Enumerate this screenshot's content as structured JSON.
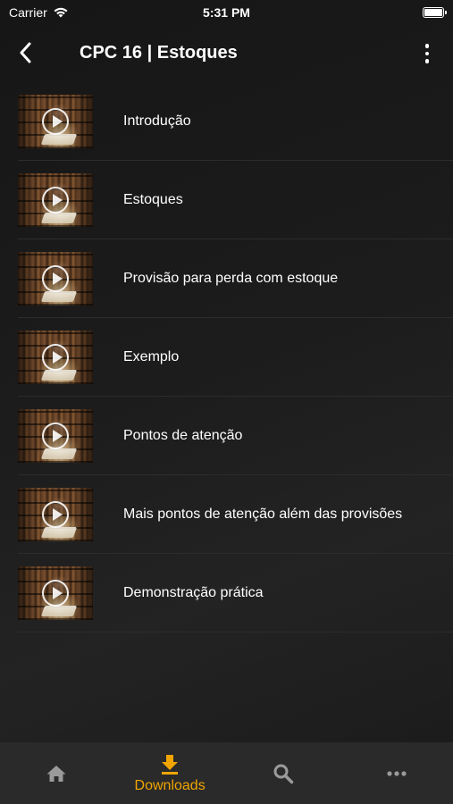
{
  "status_bar": {
    "carrier": "Carrier",
    "time": "5:31 PM",
    "battery_level": 1.0
  },
  "header": {
    "title": "CPC 16 | Estoques",
    "back_icon": "chevron-left-icon",
    "menu_icon": "vertical-dots-icon"
  },
  "lessons": [
    {
      "title": "Introdução"
    },
    {
      "title": "Estoques"
    },
    {
      "title": "Provisão para perda com estoque"
    },
    {
      "title": "Exemplo"
    },
    {
      "title": "Pontos de atenção"
    },
    {
      "title": "Mais pontos de atenção além das provisões"
    },
    {
      "title": "Demonstração prática"
    }
  ],
  "tab_bar": {
    "tabs": [
      {
        "icon": "home-icon",
        "label": "",
        "active": false
      },
      {
        "icon": "download-icon",
        "label": "Downloads",
        "active": true
      },
      {
        "icon": "search-icon",
        "label": "",
        "active": false
      },
      {
        "icon": "more-icon",
        "label": "",
        "active": false
      }
    ]
  },
  "colors": {
    "accent": "#f0a500",
    "inactive_icon": "#9a9a9a",
    "tab_bar_bg": "#2a2a2a"
  }
}
